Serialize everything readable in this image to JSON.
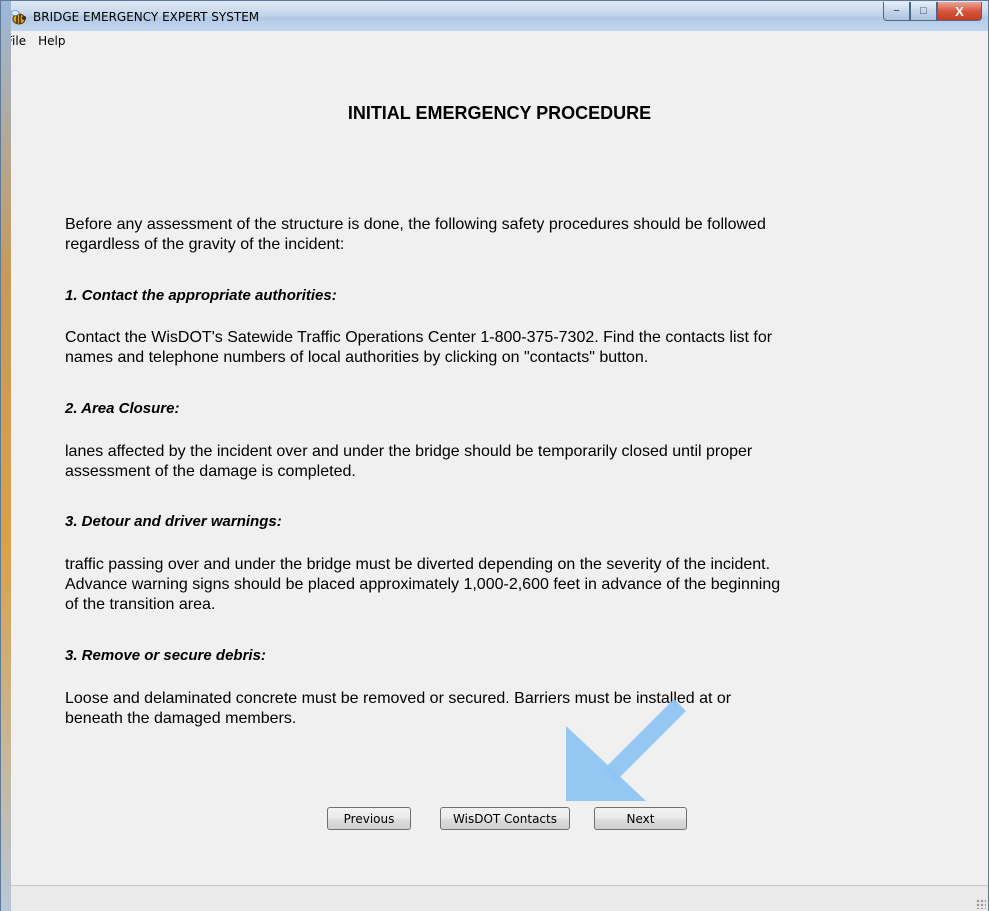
{
  "window": {
    "title": "BRIDGE EMERGENCY EXPERT SYSTEM",
    "controls": {
      "minimize": "−",
      "maximize": "□",
      "close": "X"
    }
  },
  "menu": {
    "items": [
      "File",
      "Help"
    ]
  },
  "page": {
    "heading": "INITIAL EMERGENCY PROCEDURE",
    "intro_line1": "Before any assessment of the structure is done, the following safety procedures should be followed",
    "intro_line2": "regardless of the gravity of the incident:",
    "sections": [
      {
        "title": "1.  Contact the appropriate authorities:",
        "line1": "Contact the WisDOT's Satewide Traffic Operations Center 1-800-375-7302. Find the contacts list for",
        "line2": "names and telephone numbers of local authorities by clicking on \"contacts\" button."
      },
      {
        "title": "2.  Area Closure:",
        "line1": "lanes affected by the incident over and under the bridge should be temporarily closed until proper",
        "line2": "assessment of the damage is completed."
      },
      {
        "title": "3.  Detour and driver warnings:",
        "line1": "traffic passing over and under the bridge must be diverted depending on the severity of the incident.",
        "line2": "Advance warning signs should be placed approximately 1,000-2,600 feet in advance of the beginning",
        "line3": "of the transition area."
      },
      {
        "title": "3.  Remove or secure debris:",
        "line1": "Loose and delaminated concrete must be removed or secured. Barriers must be installed at or",
        "line2": "beneath the damaged members."
      }
    ]
  },
  "buttons": {
    "previous": "Previous",
    "contacts": "WisDOT Contacts",
    "next": "Next"
  },
  "colors": {
    "arrow": "#8fc4f2",
    "close_button": "#c94a32"
  }
}
